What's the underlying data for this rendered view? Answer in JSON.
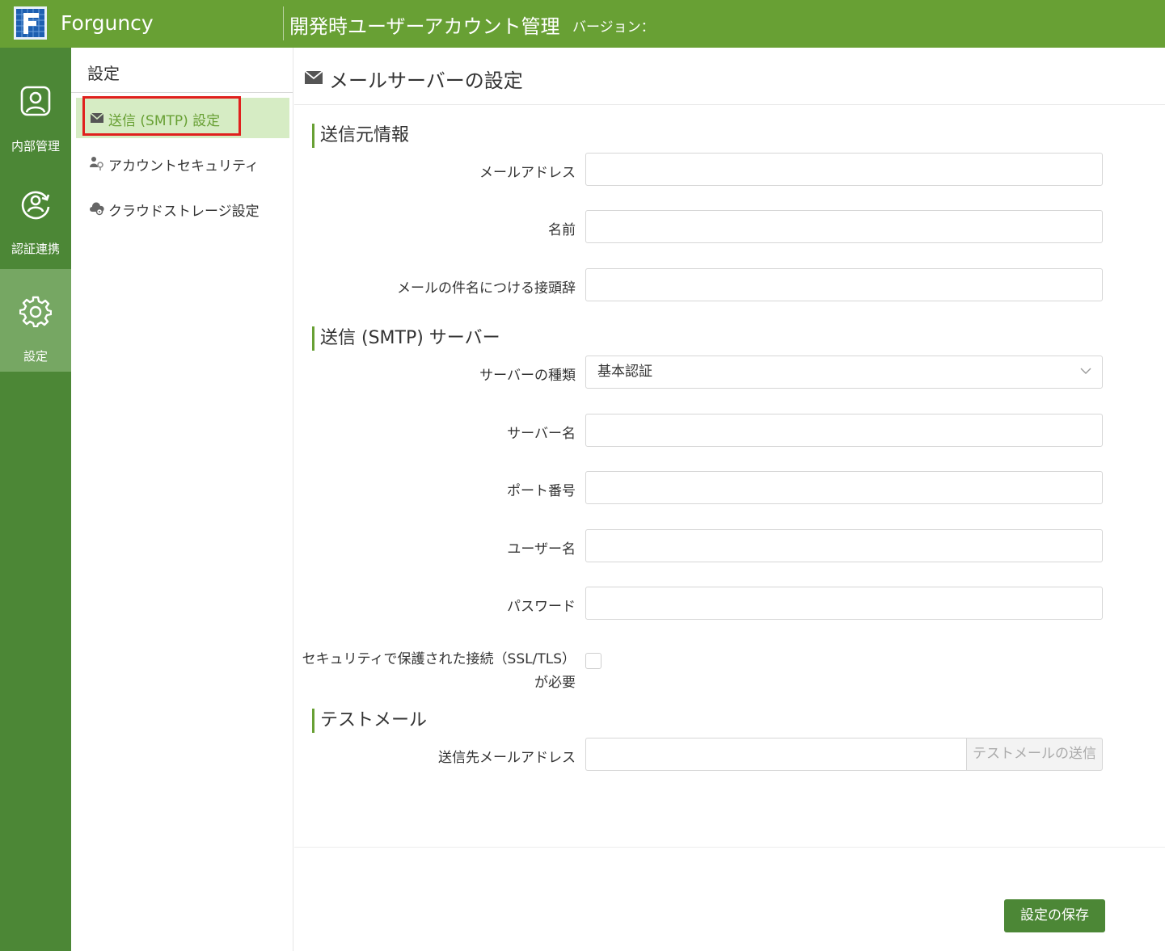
{
  "header": {
    "app_name": "Forguncy",
    "title": "開発時ユーザーアカウント管理",
    "version_label": "バージョン："
  },
  "rail": {
    "items": [
      {
        "label": "内部管理",
        "icon": "user-square-icon"
      },
      {
        "label": "認証連携",
        "icon": "user-sync-icon"
      },
      {
        "label": "設定",
        "icon": "gear-icon",
        "active": true
      }
    ]
  },
  "sidebar": {
    "title": "設定",
    "items": [
      {
        "label": "送信 (SMTP) 設定",
        "icon": "envelope-icon",
        "active": true
      },
      {
        "label": "アカウントセキュリティ",
        "icon": "account-key-icon"
      },
      {
        "label": "クラウドストレージ設定",
        "icon": "cloud-gear-icon"
      }
    ]
  },
  "main": {
    "title": "メールサーバーの設定",
    "sections": {
      "sender": "送信元情報",
      "smtp": "送信 (SMTP) サーバー",
      "test": "テストメール"
    },
    "fields": {
      "email": {
        "label": "メールアドレス",
        "value": ""
      },
      "name": {
        "label": "名前",
        "value": ""
      },
      "prefix": {
        "label": "メールの件名につける接頭辞",
        "value": ""
      },
      "server_type": {
        "label": "サーバーの種類",
        "value": "基本認証"
      },
      "server_name": {
        "label": "サーバー名",
        "value": ""
      },
      "port": {
        "label": "ポート番号",
        "value": ""
      },
      "username": {
        "label": "ユーザー名",
        "value": ""
      },
      "password": {
        "label": "パスワード",
        "value": ""
      },
      "ssl": {
        "label_line1": "セキュリティで保護された接続（SSL/TLS）",
        "label_line2": "が必要",
        "checked": false
      },
      "test_to": {
        "label": "送信先メールアドレス",
        "value": ""
      }
    },
    "test_button": "テストメールの送信",
    "save_button": "設定の保存"
  },
  "colors": {
    "header": "#68a034",
    "rail": "#4c8736",
    "rail_active": "#76a763",
    "sidebar_active": "#d6ecc4",
    "highlight": "#e0201d"
  }
}
